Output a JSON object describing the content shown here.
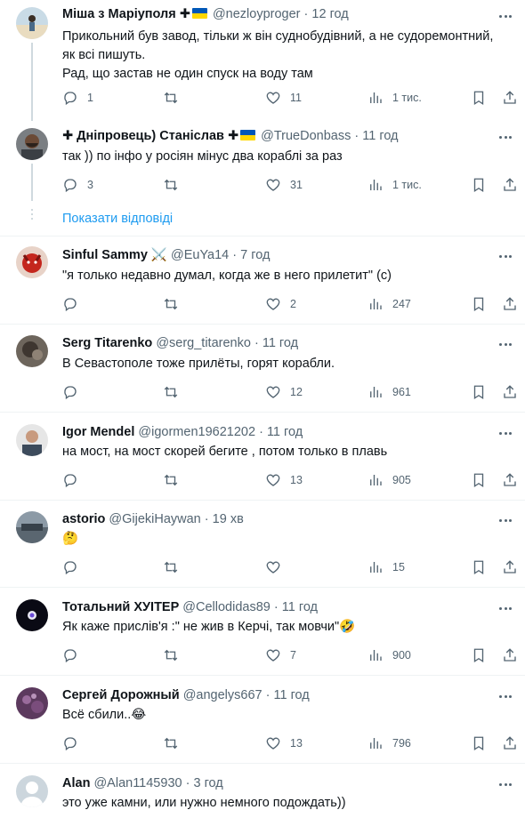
{
  "replies_link": "Показати відповіді",
  "tweets": [
    {
      "name": "Міша з Маріуполя ✚",
      "handle": "@nezloyproger",
      "time": "12 год",
      "lines": [
        "Прикольний був завод, тільки ж він суднобудівний, а не судоремонтний,",
        "як всі пишуть.",
        "Рад, що застав не один спуск на воду там"
      ],
      "replies": "1",
      "retweets": "",
      "likes": "11",
      "views": "1 тис."
    },
    {
      "name_prefix": "✚ Дніпровець) Станіслав ✚",
      "handle": "@TrueDonbass",
      "time": "11 год",
      "lines": [
        "так )) по інфо у росіян мінус два кораблі за раз"
      ],
      "replies": "3",
      "retweets": "",
      "likes": "31",
      "views": "1 тис."
    },
    {
      "name": "Sinful Sammy ⚔️",
      "handle": "@EuYa14",
      "time": "7 год",
      "lines": [
        "\"я только недавно думал, когда же в него прилетит\" (с)"
      ],
      "replies": "",
      "retweets": "",
      "likes": "2",
      "views": "247"
    },
    {
      "name": "Serg Titarenko",
      "handle": "@serg_titarenko",
      "time": "11 год",
      "lines": [
        "В Севастополе тоже прилёты, горят корабли."
      ],
      "replies": "",
      "retweets": "",
      "likes": "12",
      "views": "961"
    },
    {
      "name": "Igor Mendel",
      "handle": "@igormen19621202",
      "time": "11 год",
      "lines": [
        "на мост, на мост скорей бегите , потом только в плавь"
      ],
      "replies": "",
      "retweets": "",
      "likes": "13",
      "views": "905"
    },
    {
      "name": "astorio",
      "handle": "@GijekiHaywan",
      "time": "19 хв",
      "lines": [
        "🤔"
      ],
      "replies": "",
      "retweets": "",
      "likes": "",
      "views": "15"
    },
    {
      "name": "Тотальний ХУІТЕР",
      "handle": "@Cellodidas89",
      "time": "11 год",
      "lines": [
        "Як каже прислів'я :\" не жив в Керчі, так мовчи\"🤣"
      ],
      "replies": "",
      "retweets": "",
      "likes": "7",
      "views": "900"
    },
    {
      "name": "Сергей Дорожный",
      "handle": "@angelys667",
      "time": "11 год",
      "lines": [
        "Всё сбили..😂"
      ],
      "replies": "",
      "retweets": "",
      "likes": "13",
      "views": "796"
    },
    {
      "name": "Alan",
      "handle": "@Alan1145930",
      "time": "3 год",
      "lines": [
        "это уже камни, или нужно немного подождать))"
      ],
      "replies": "",
      "retweets": "",
      "likes": "",
      "views": ""
    }
  ]
}
